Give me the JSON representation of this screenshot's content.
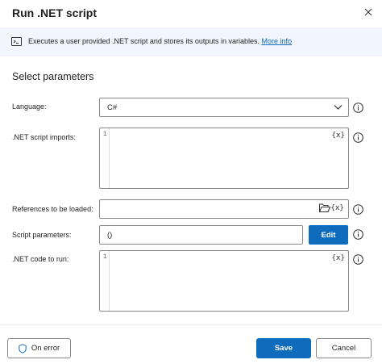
{
  "dialog": {
    "title": "Run .NET script",
    "close_icon": "close-icon"
  },
  "info": {
    "icon": "console-icon",
    "text": "Executes a user provided .NET script and stores its outputs in variables.",
    "link": "More info"
  },
  "section_title": "Select parameters",
  "fields": {
    "language": {
      "label": "Language:",
      "value": "C#"
    },
    "imports": {
      "label": ".NET script imports:",
      "line_number": "1",
      "var_button": "{x}"
    },
    "references": {
      "label": "References to be loaded:",
      "var_button": "{x}"
    },
    "script_params": {
      "label": "Script parameters:",
      "value": "()",
      "edit_label": "Edit"
    },
    "code": {
      "label": ".NET code to run:",
      "line_number": "1",
      "var_button": "{x}"
    }
  },
  "footer": {
    "on_error_label": "On error",
    "save_label": "Save",
    "cancel_label": "Cancel"
  },
  "colors": {
    "accent": "#0f6cbd",
    "info_bar_bg": "#f2f6fc"
  }
}
